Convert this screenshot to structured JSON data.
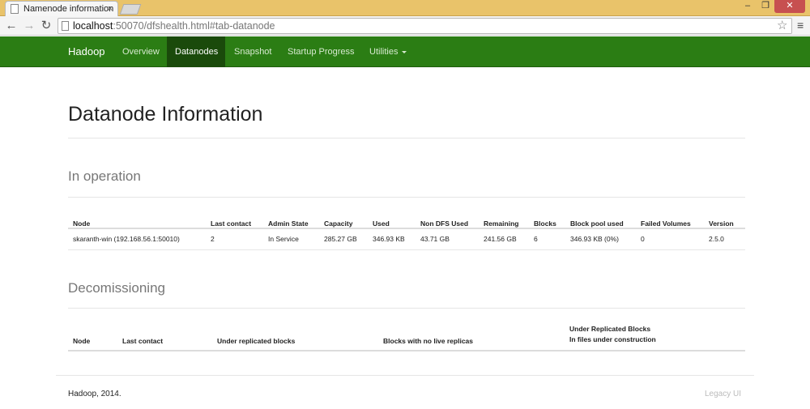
{
  "browser": {
    "tab_title": "Namenode information",
    "tab_close": "×",
    "url_host": "localhost",
    "url_path": ":50070/dfshealth.html#tab-datanode",
    "window_min": "–",
    "window_max": "❐",
    "window_close": "✕",
    "back_glyph": "←",
    "forward_glyph": "→",
    "reload_glyph": "↻",
    "star_glyph": "☆",
    "menu_glyph": "≡"
  },
  "navbar": {
    "brand": "Hadoop",
    "items": [
      "Overview",
      "Datanodes",
      "Snapshot",
      "Startup Progress",
      "Utilities"
    ],
    "active": "Datanodes",
    "colors": {
      "background": "#2b7d14",
      "active": "#1a4a0b"
    }
  },
  "page": {
    "title": "Datanode Information",
    "in_operation": {
      "heading": "In operation",
      "columns": [
        "Node",
        "Last contact",
        "Admin State",
        "Capacity",
        "Used",
        "Non DFS Used",
        "Remaining",
        "Blocks",
        "Block pool used",
        "Failed Volumes",
        "Version"
      ],
      "rows": [
        [
          "skaranth-win (192.168.56.1:50010)",
          "2",
          "In Service",
          "285.27 GB",
          "346.93 KB",
          "43.71 GB",
          "241.56 GB",
          "6",
          "346.93 KB (0%)",
          "0",
          "2.5.0"
        ]
      ]
    },
    "decommissioning": {
      "heading": "Decomissioning",
      "columns": [
        "Node",
        "Last contact",
        "Under replicated blocks",
        "Blocks with no live replicas",
        "Under Replicated Blocks",
        "In files under construction"
      ]
    }
  },
  "footer": {
    "left": "Hadoop, 2014.",
    "right": "Legacy UI"
  }
}
